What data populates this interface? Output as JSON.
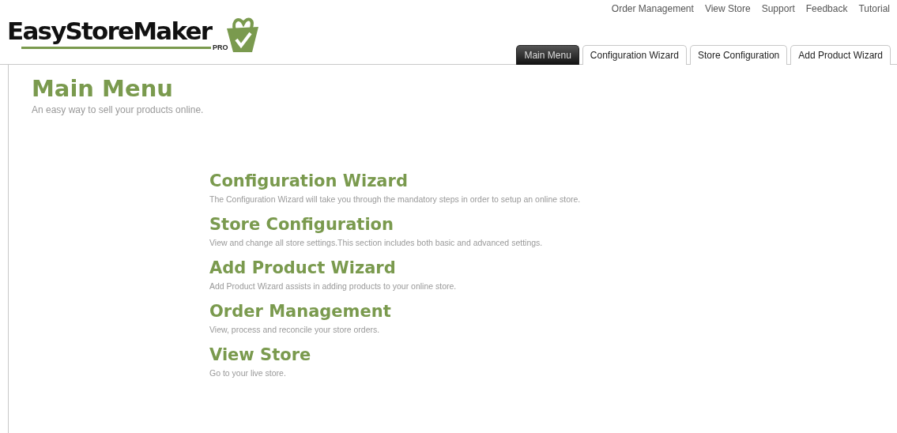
{
  "logo": {
    "name": "EasyStoreMaker",
    "edition": "PRO"
  },
  "top_links": [
    "Order Management",
    "View Store",
    "Support",
    "Feedback",
    "Tutorial"
  ],
  "tabs": [
    {
      "label": "Main Menu",
      "selected": true
    },
    {
      "label": "Configuration Wizard",
      "selected": false
    },
    {
      "label": "Store Configuration",
      "selected": false
    },
    {
      "label": "Add Product Wizard",
      "selected": false
    }
  ],
  "page": {
    "title": "Main Menu",
    "subtitle": "An easy way to sell your products online."
  },
  "sections": [
    {
      "title": "Configuration Wizard",
      "description": "The Configuration Wizard will take you through the mandatory steps in order to setup an online store."
    },
    {
      "title": "Store Configuration",
      "description": "View and change all store settings.This section includes both basic and advanced settings."
    },
    {
      "title": "Add Product Wizard",
      "description": "Add Product Wizard assists in adding products to your online store."
    },
    {
      "title": "Order Management",
      "description": "View, process and reconcile your store orders."
    },
    {
      "title": "View Store",
      "description": "Go to your live store."
    }
  ]
}
